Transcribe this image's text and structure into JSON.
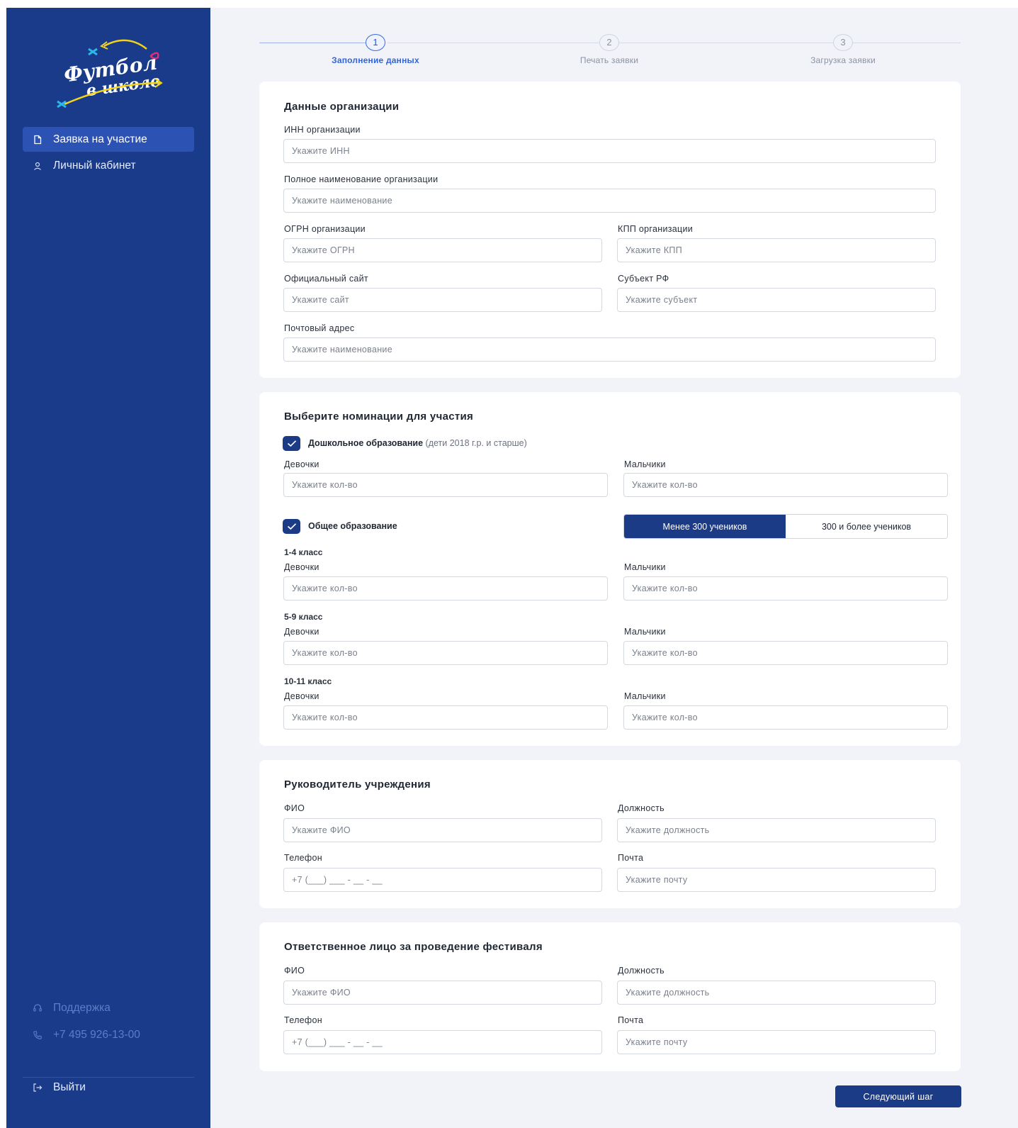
{
  "sidebar": {
    "logo_text": "Футбол в школе",
    "items": [
      {
        "label": "Заявка на участие",
        "icon": "document-icon"
      },
      {
        "label": "Личный кабинет",
        "icon": "user-icon"
      }
    ],
    "support_label": "Поддержка",
    "phone": "+7 495 926-13-00",
    "logout_label": "Выйти"
  },
  "stepper": {
    "steps": [
      {
        "number": "1",
        "label": "Заполнение данных"
      },
      {
        "number": "2",
        "label": "Печать заявки"
      },
      {
        "number": "3",
        "label": "Загрузка заявки"
      }
    ]
  },
  "organization": {
    "title": "Данные организации",
    "inn_label": "ИНН организации",
    "inn_placeholder": "Укажите ИНН",
    "fullname_label": "Полное наименование организации",
    "fullname_placeholder": "Укажите наименование",
    "ogrn_label": "ОГРН организации",
    "ogrn_placeholder": "Укажите ОГРН",
    "kpp_label": "КПП организации",
    "kpp_placeholder": "Укажите КПП",
    "site_label": "Официальный сайт",
    "site_placeholder": "Укажите сайт",
    "subject_label": "Субъект РФ",
    "subject_placeholder": "Укажите субъект",
    "address_label": "Почтовый адрес",
    "address_placeholder": "Укажите наименование"
  },
  "nominations": {
    "title": "Выберите номинации для участия",
    "preschool_label": "Дошкольное образование",
    "preschool_note": "(дети 2018 г.р. и старше)",
    "girls_label": "Девочки",
    "boys_label": "Мальчики",
    "count_placeholder": "Укажите кол-во",
    "general_label": "Общее образование",
    "seg_less": "Менее 300 учеников",
    "seg_more": "300 и более учеников",
    "grade_1_4": "1-4 класс",
    "grade_5_9": "5-9 класс",
    "grade_10_11": "10-11 класс"
  },
  "head": {
    "title": "Руководитель учреждения",
    "fio_label": "ФИО",
    "fio_placeholder": "Укажите ФИО",
    "position_label": "Должность",
    "position_placeholder": "Укажите должность",
    "phone_label": "Телефон",
    "phone_placeholder": "+7 (___) ___ - __ - __",
    "email_label": "Почта",
    "email_placeholder": "Укажите почту"
  },
  "responsible": {
    "title": "Ответственное лицо за проведение фестиваля",
    "fio_label": "ФИО",
    "fio_placeholder": "Укажите ФИО",
    "position_label": "Должность",
    "position_placeholder": "Укажите должность",
    "phone_label": "Телефон",
    "phone_placeholder": "+7 (___) ___ - __ - __",
    "email_label": "Почта",
    "email_placeholder": "Укажите почту"
  },
  "next_button": "Следующий шаг",
  "colors": {
    "sidebar_bg": "#1a3a8a",
    "active_nav": "#2c53b3",
    "primary": "#1c3b86",
    "step_active": "#2f66df",
    "logo_yellow": "#f2d21b",
    "logo_pink": "#e0307a",
    "logo_cyan": "#2bb8e8"
  }
}
